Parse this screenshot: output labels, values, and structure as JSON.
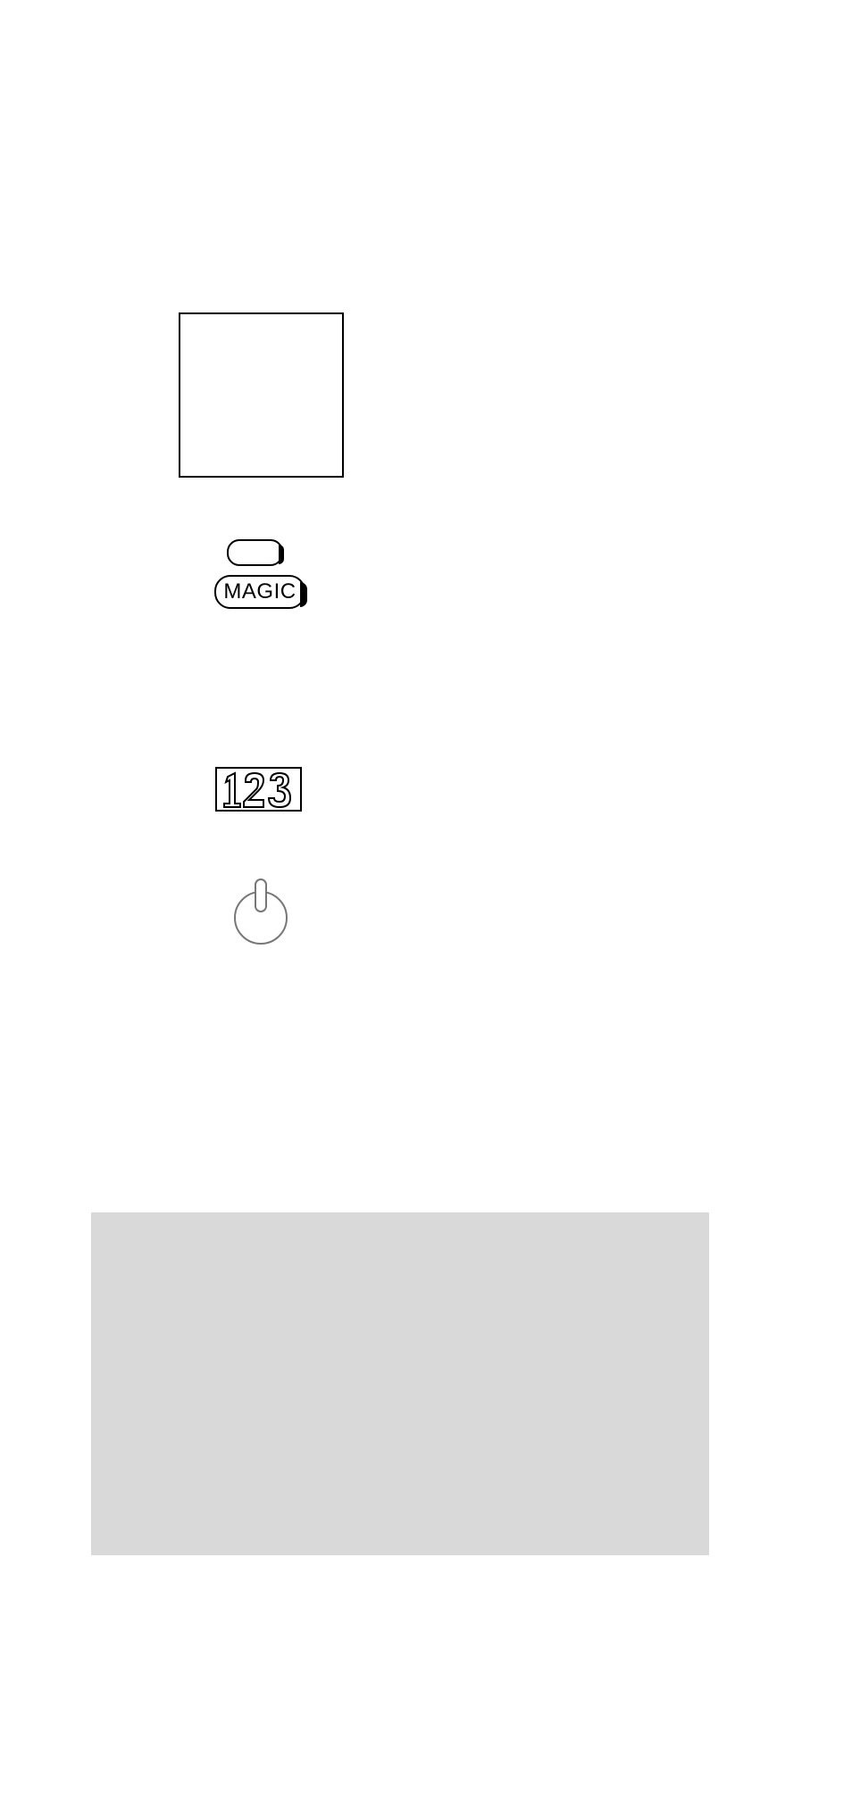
{
  "magicLabel": "MAGIC",
  "numberLabel": "123"
}
